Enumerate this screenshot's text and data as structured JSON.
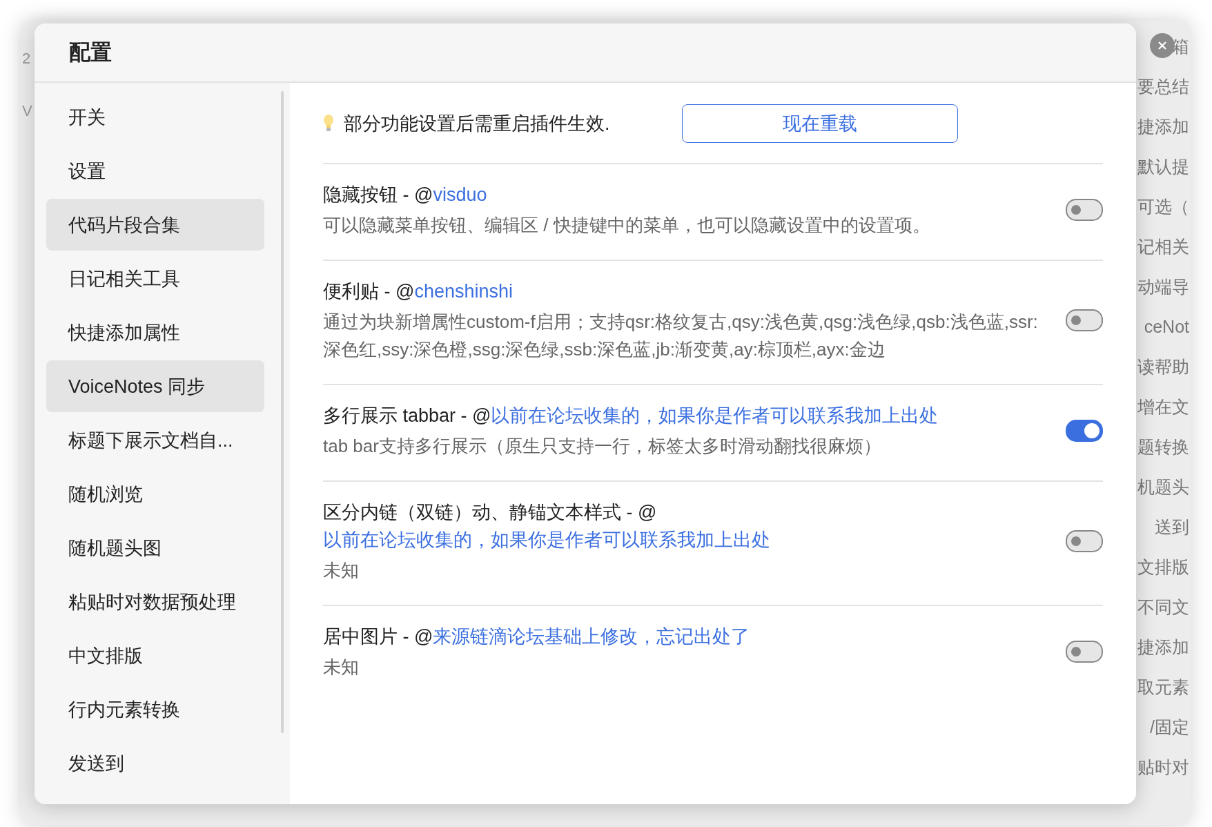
{
  "background": {
    "left_fragments": [
      "2",
      "V"
    ],
    "right_column": [
      "箱",
      "要总结",
      "捷添加",
      "默认提",
      "可选（",
      "记相关",
      "动端导",
      "ceNot",
      "读帮助",
      "增在文",
      "题转换",
      "机题头",
      "送到",
      "文排版",
      "不同文",
      "捷添加",
      "取元素",
      "/固定",
      "贴时对"
    ]
  },
  "dialog": {
    "title": "配置",
    "sidebar": {
      "items": [
        {
          "label": "开关",
          "selected": false
        },
        {
          "label": "设置",
          "selected": false
        },
        {
          "label": "代码片段合集",
          "selected": true
        },
        {
          "label": "日记相关工具",
          "selected": false
        },
        {
          "label": "快捷添加属性",
          "selected": false
        },
        {
          "label": "VoiceNotes 同步",
          "selected": true
        },
        {
          "label": "标题下展示文档自...",
          "selected": false
        },
        {
          "label": "随机浏览",
          "selected": false
        },
        {
          "label": "随机题头图",
          "selected": false
        },
        {
          "label": "粘贴时对数据预处理",
          "selected": false
        },
        {
          "label": "中文排版",
          "selected": false
        },
        {
          "label": "行内元素转换",
          "selected": false
        },
        {
          "label": "发送到",
          "selected": false
        }
      ]
    },
    "notice": {
      "text": "部分功能设置后需重启插件生效.",
      "button": "现在重载"
    },
    "settings": [
      {
        "title": "隐藏按钮 - @",
        "link": "visduo",
        "description": "可以隐藏菜单按钮、编辑区 / 快捷键中的菜单，也可以隐藏设置中的设置项。",
        "on": false
      },
      {
        "title": "便利贴 - @",
        "link": "chenshinshi",
        "description": "通过为块新增属性custom-f启用；支持qsr:格纹复古,qsy:浅色黄,qsg:浅色绿,qsb:浅色蓝,ssr:深色红,ssy:深色橙,ssg:深色绿,ssb:深色蓝,jb:渐变黄,ay:棕顶栏,ayx:金边",
        "on": false
      },
      {
        "title": "多行展示 tabbar - @",
        "link": "以前在论坛收集的，如果你是作者可以联系我加上出处",
        "description": "tab bar支持多行展示（原生只支持一行，标签太多时滑动翻找很麻烦）",
        "on": true
      },
      {
        "title": "区分内链（双链）动、静锚文本样式 - @",
        "link": "以前在论坛收集的，如果你是作者可以联系我加上出处",
        "description": "未知",
        "on": false
      },
      {
        "title": "居中图片 - @",
        "link": "来源链滴论坛基础上修改，忘记出处了",
        "description": "未知",
        "on": false
      }
    ]
  }
}
